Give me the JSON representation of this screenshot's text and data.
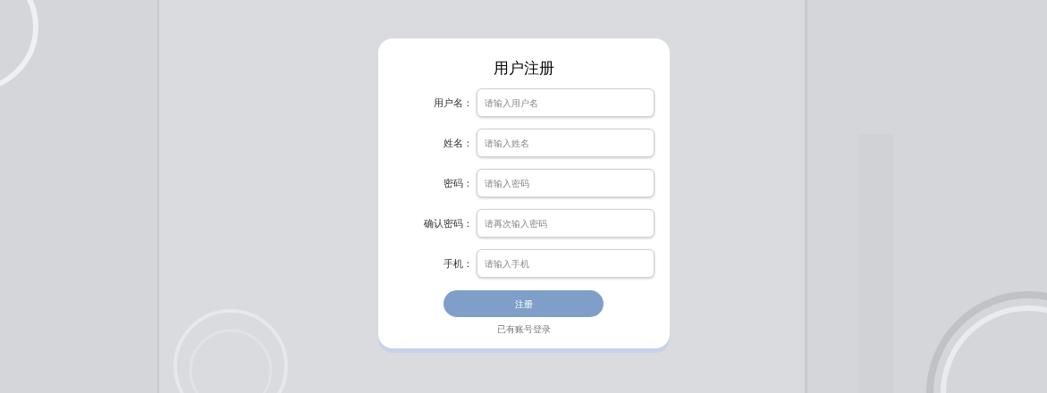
{
  "form": {
    "title": "用户注册",
    "fields": [
      {
        "label": "用户名：",
        "placeholder": "请输入用户名"
      },
      {
        "label": "姓名：",
        "placeholder": "请输入姓名"
      },
      {
        "label": "密码：",
        "placeholder": "请输入密码"
      },
      {
        "label": "确认密码：",
        "placeholder": "请再次输入密码"
      },
      {
        "label": "手机：",
        "placeholder": "请输入手机"
      }
    ],
    "submit": "注册",
    "login_link": "已有账号登录"
  }
}
